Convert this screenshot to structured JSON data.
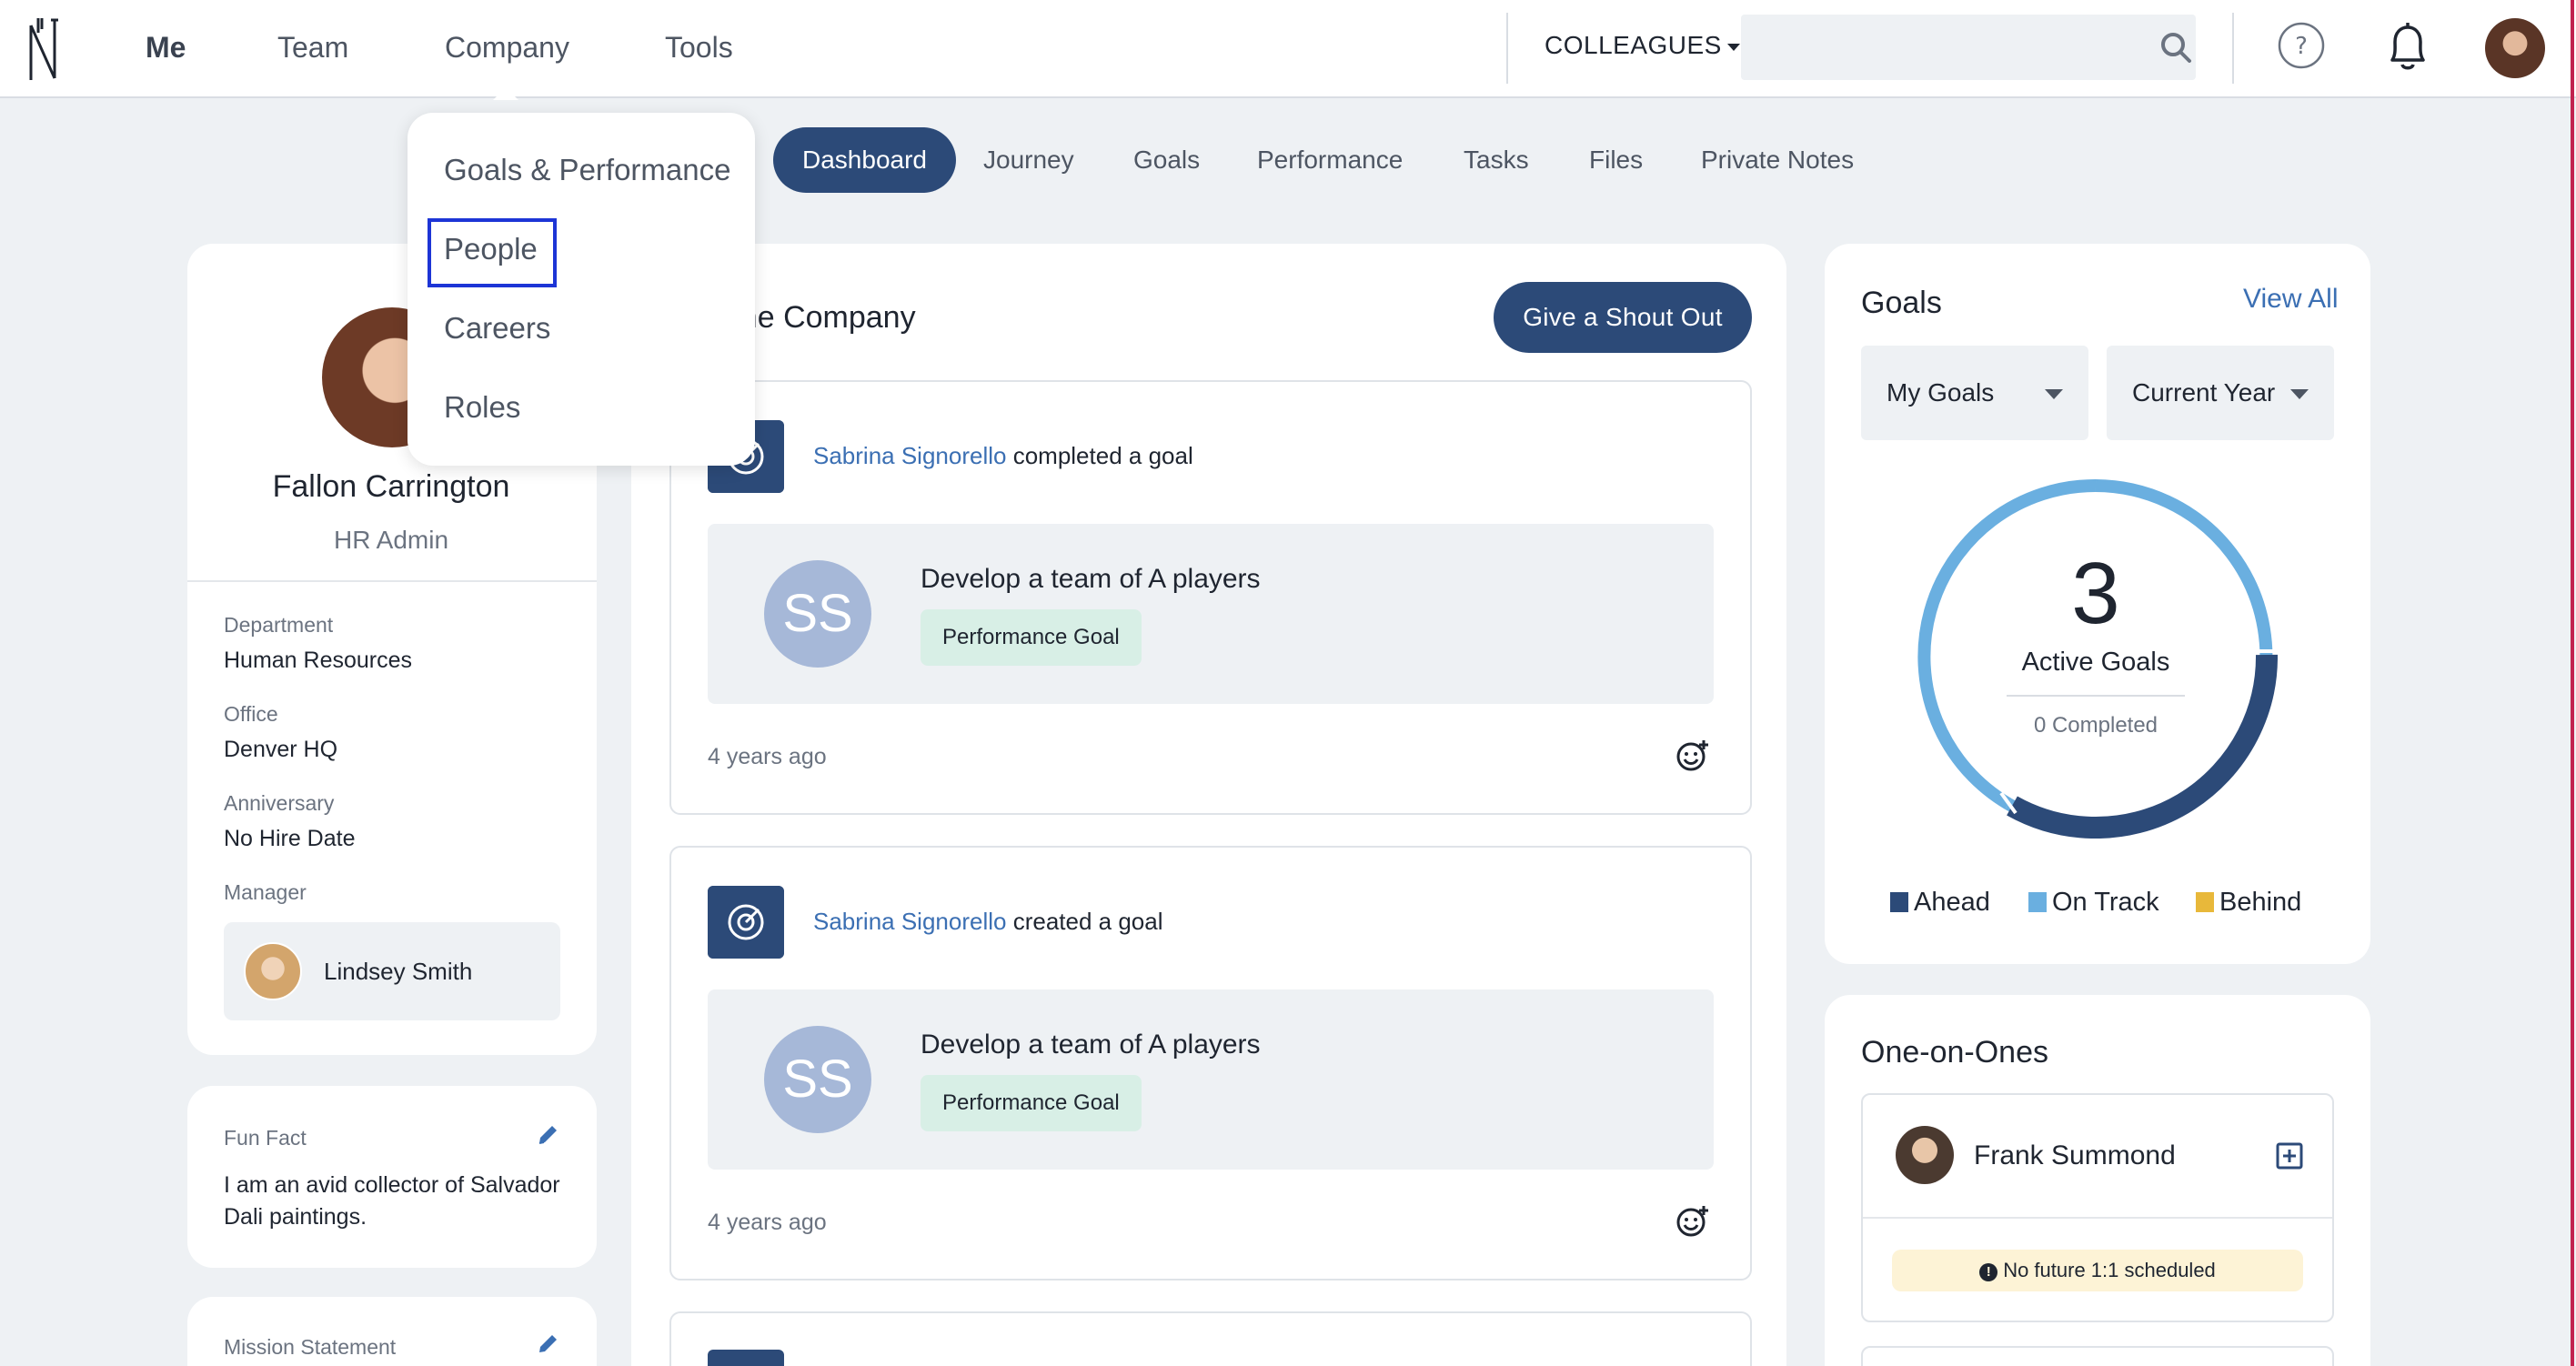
{
  "nav": {
    "items": [
      "Me",
      "Team",
      "Company",
      "Tools"
    ],
    "colleagues_label": "COLLEAGUES",
    "search_placeholder": ""
  },
  "company_menu": {
    "items": [
      "Goals & Performance",
      "People",
      "Careers",
      "Roles"
    ],
    "highlighted": "People"
  },
  "subtabs": [
    "Dashboard",
    "Journey",
    "Goals",
    "Performance",
    "Tasks",
    "Files",
    "Private Notes"
  ],
  "active_subtab": "Dashboard",
  "profile": {
    "name": "Fallon Carrington",
    "role": "HR Admin",
    "fields": [
      {
        "label": "Department",
        "value": "Human Resources"
      },
      {
        "label": "Office",
        "value": "Denver HQ"
      },
      {
        "label": "Anniversary",
        "value": "No Hire Date"
      },
      {
        "label": "Manager",
        "value": ""
      }
    ],
    "manager_name": "Lindsey Smith"
  },
  "fun_fact": {
    "label": "Fun Fact",
    "text": "I am an avid collector of Salvador Dali paintings."
  },
  "mission": {
    "label": "Mission Statement"
  },
  "feed": {
    "title_visible": "d the Company",
    "shoutout_button": "Give a Shout Out",
    "posts": [
      {
        "who": "Sabrina Signorello",
        "action": "completed a goal",
        "initials": "SS",
        "goal_title": "Develop a team of A players",
        "tag": "Performance Goal",
        "time": "4 years ago"
      },
      {
        "who": "Sabrina Signorello",
        "action": "created a goal",
        "initials": "SS",
        "goal_title": "Develop a team of A players",
        "tag": "Performance Goal",
        "time": "4 years ago"
      }
    ]
  },
  "goals": {
    "title": "Goals",
    "view_all": "View All",
    "filter_owner": "My Goals",
    "filter_period": "Current Year",
    "active_count": "3",
    "active_label": "Active Goals",
    "completed_label": "0 Completed",
    "legend": [
      {
        "name": "Ahead",
        "color": "#2c4a78"
      },
      {
        "name": "On Track",
        "color": "#6aafe0"
      },
      {
        "name": "Behind",
        "color": "#e8b83a"
      }
    ]
  },
  "one_on_ones": {
    "title": "One-on-Ones",
    "person": "Frank Summond",
    "status": "No future 1:1 scheduled"
  }
}
